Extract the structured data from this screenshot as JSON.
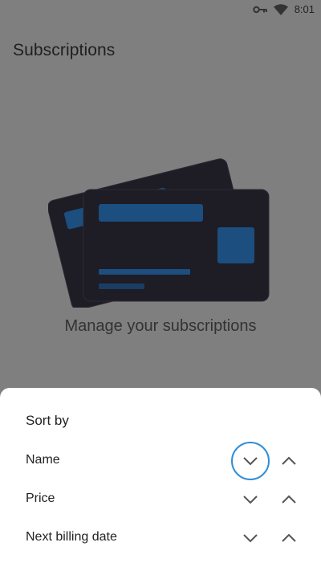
{
  "status_bar": {
    "time": "8:01",
    "icons": [
      "key-icon",
      "wifi-icon"
    ]
  },
  "page": {
    "title": "Subscriptions",
    "empty_state": "Manage your subscriptions"
  },
  "sort_sheet": {
    "title": "Sort by",
    "options": [
      {
        "label": "Name",
        "selected_direction": "descending"
      },
      {
        "label": "Price"
      },
      {
        "label": "Next billing date"
      }
    ]
  },
  "colors": {
    "accent": "#2f8fd8",
    "card_dark": "#1e1c25",
    "card_blue": "#1c4e80"
  }
}
